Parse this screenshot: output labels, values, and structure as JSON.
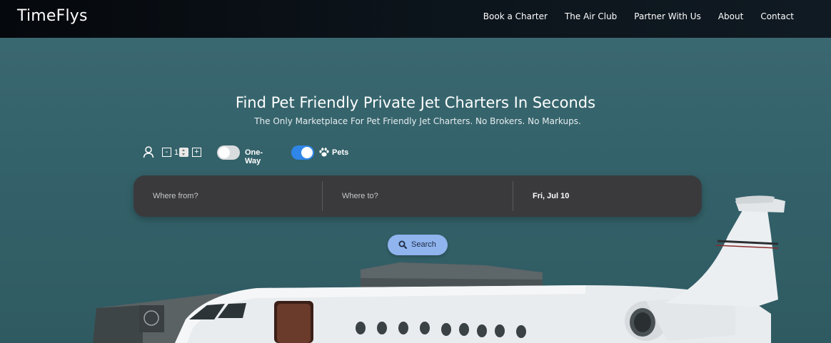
{
  "brand": "TimeFlys",
  "nav": [
    {
      "label": "Book a Charter"
    },
    {
      "label": "The Air Club"
    },
    {
      "label": "Partner With Us"
    },
    {
      "label": "About"
    },
    {
      "label": "Contact"
    }
  ],
  "hero": {
    "title": "Find Pet Friendly Private Jet Charters In Seconds",
    "subtitle": "The Only Marketplace For Pet Friendly Jet Charters. No Brokers. No Markups."
  },
  "options": {
    "passenger_icon": "person-icon",
    "passenger_count": "1",
    "minus_label": "-",
    "plus_label": "+",
    "one_way_label": "One-Way",
    "one_way_enabled": false,
    "pets_label": "Pets",
    "pets_icon": "paw-icon",
    "pets_enabled": true
  },
  "search": {
    "from_placeholder": "Where from?",
    "to_placeholder": "Where to?",
    "date": "Fri, Jul 10",
    "button_label": "Search",
    "button_icon": "search-icon"
  },
  "colors": {
    "toggle_on": "#2f86e8",
    "search_button": "#8fb4ee",
    "search_bar": "#3a3a3d"
  }
}
